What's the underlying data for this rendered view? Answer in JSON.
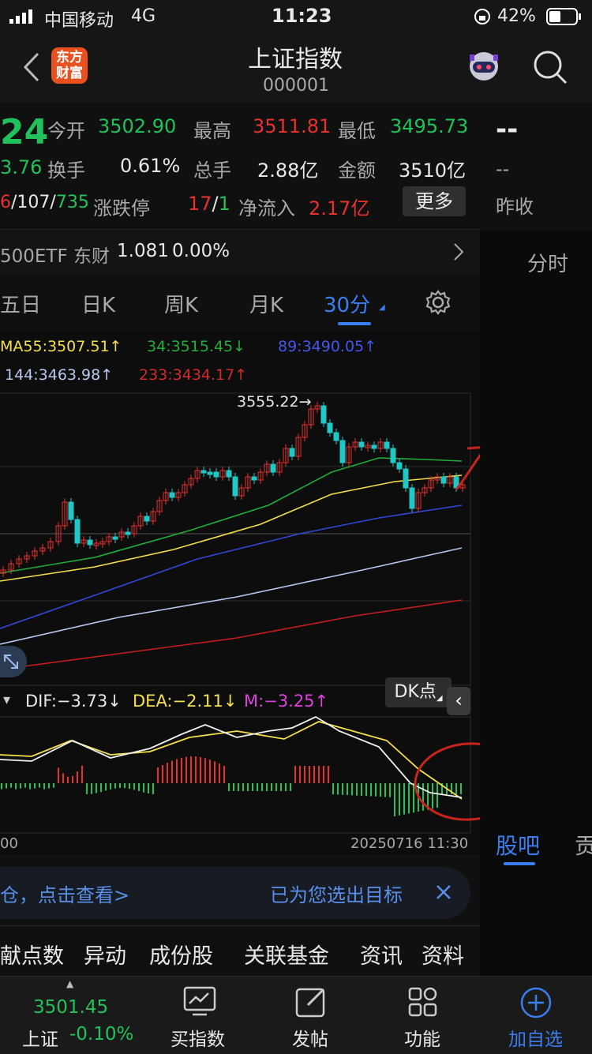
{
  "status": {
    "carrier": "中国移动",
    "network": "4G",
    "time": "11:23",
    "battery": "42%"
  },
  "header": {
    "title": "上证指数",
    "code": "000001",
    "logo_text": "东方财富"
  },
  "quote": {
    "price_fragment": "24",
    "change_fragment": "3.76",
    "ratio_fragment_red": "6",
    "ratio_mid": "/107/",
    "ratio_green": "735",
    "open_label": "今开",
    "open_value": "3502.90",
    "high_label": "最高",
    "high_value": "3511.81",
    "low_label": "最低",
    "low_value": "3495.73",
    "turnover_label": "换手",
    "turnover_value": "0.61%",
    "volume_label": "总手",
    "volume_value": "2.88亿",
    "amount_label": "金额",
    "amount_value": "3510亿",
    "limit_label": "涨跌停",
    "limit_up": "17",
    "limit_sep": "/",
    "limit_down": "1",
    "netflow_label": "净流入",
    "netflow_value": "2.17亿",
    "more_label": "更多"
  },
  "right_panel": {
    "dash1": "--",
    "dash2": "--",
    "prev_close_label": "昨收",
    "tab_intraday": "分时",
    "tab_guba": "股吧",
    "tab_cut": "贡"
  },
  "etf": {
    "name": "500ETF 东财",
    "price": "1.081",
    "change": "0.00%"
  },
  "tabs": [
    "五日",
    "日K",
    "周K",
    "月K"
  ],
  "active_tab": "30分",
  "ma": {
    "ma55": "MA55:3507.51↑",
    "ma34": "34:3515.45↓",
    "ma89": "89:3490.05↑",
    "ma144": "144:3463.98↑",
    "ma233": "233:3434.17↑"
  },
  "dk_label": "DK点",
  "peak_label": "3555.22→",
  "macd": {
    "dif": "DIF:−3.73↓",
    "dea": "DEA:−2.11↓",
    "m": "M:−3.25↑"
  },
  "time_left": "00",
  "time_right": "20250716 11:30",
  "banner": {
    "left": "仓，点击查看>",
    "right": "已为您选出目标"
  },
  "bottom_tabs": [
    "献点数",
    "异动",
    "成份股",
    "关联基金",
    "资讯",
    "资料"
  ],
  "footer": {
    "index_value": "3501.45",
    "index_name": "上证",
    "index_change": "-0.10%",
    "buy": "买指数",
    "post": "发帖",
    "func": "功能",
    "add": "加自选"
  },
  "colors": {
    "up": "#e8302f",
    "down": "#21c25b",
    "accent": "#3a7ef0",
    "ma_yellow": "#f5e04a",
    "ma_green": "#1fae3a",
    "ma_blue": "#3347d6",
    "ma_light": "#b7c9f0",
    "ma_red": "#c61e1e"
  }
}
